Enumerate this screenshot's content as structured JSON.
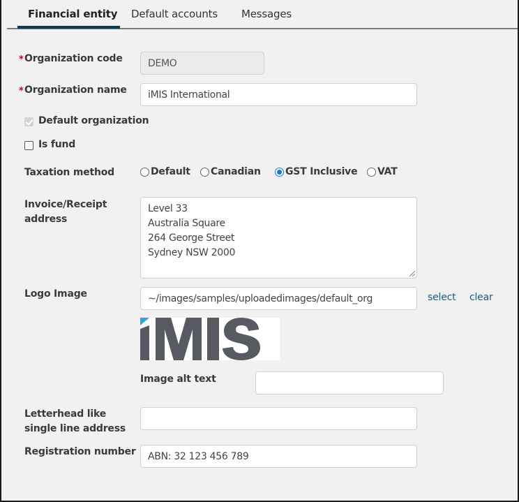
{
  "tabs": [
    {
      "label": "Financial entity",
      "active": true
    },
    {
      "label": "Default accounts",
      "active": false
    },
    {
      "label": "Messages",
      "active": false
    }
  ],
  "form": {
    "organization_code": {
      "label": "Organization code",
      "required": true,
      "value": "DEMO",
      "disabled": true
    },
    "organization_name": {
      "label": "Organization name",
      "required": true,
      "value": "iMIS International"
    },
    "default_organization": {
      "label": "Default organization",
      "checked": true,
      "disabled": true
    },
    "is_fund": {
      "label": "Is fund",
      "checked": false
    },
    "taxation_method": {
      "label": "Taxation method",
      "options": [
        "Default",
        "Canadian",
        "GST Inclusive",
        "VAT"
      ],
      "selected": "GST Inclusive"
    },
    "invoice_address": {
      "label_line1": "Invoice/Receipt",
      "label_line2": "address",
      "lines": [
        "Level 33",
        "Australia Square",
        "264 George Street",
        "Sydney NSW 2000"
      ]
    },
    "logo_image": {
      "label": "Logo Image",
      "value": "~/images/samples/uploadedimages/default_org",
      "select_label": "select",
      "clear_label": "clear",
      "logo_text": "iMIS",
      "logo_colors": {
        "accent": "#29a8e0",
        "text": "#575a61"
      }
    },
    "image_alt_text": {
      "label": "Image alt text",
      "value": ""
    },
    "letterhead_address": {
      "label_line1": "Letterhead like",
      "label_line2": "single line address",
      "value": ""
    },
    "registration_number": {
      "label": "Registration number",
      "value": "ABN: 32 123 456 789"
    }
  },
  "colors": {
    "tab_underline": "#0e3b52",
    "required": "#d0021b",
    "link": "#1a5e7e",
    "radio_checked": "#1a73e8"
  }
}
